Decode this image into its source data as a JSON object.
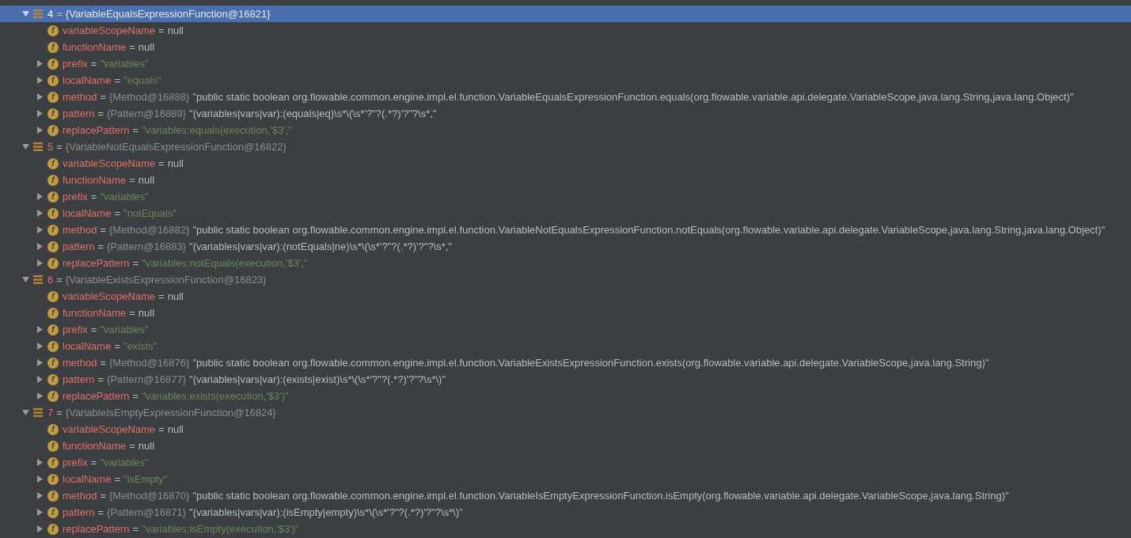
{
  "groups": [
    {
      "index": "4",
      "op": "=",
      "value": "{VariableEqualsExpressionFunction@16821}",
      "expanded": true,
      "selected": true,
      "children": [
        {
          "icon": "f",
          "name": "variableScopeName",
          "op": "=",
          "kind": "null",
          "value": "null",
          "expandable": false
        },
        {
          "icon": "f",
          "name": "functionName",
          "op": "=",
          "kind": "null",
          "value": "null",
          "expandable": false
        },
        {
          "icon": "f",
          "name": "prefix",
          "op": "=",
          "kind": "string",
          "value": "\"variables\"",
          "expandable": true
        },
        {
          "icon": "f",
          "name": "localName",
          "op": "=",
          "kind": "string",
          "value": "\"equals\"",
          "expandable": true
        },
        {
          "icon": "f",
          "name": "method",
          "op": "=",
          "kind": "object",
          "ref": "{Method@16888}",
          "value": "\"public static boolean org.flowable.common.engine.impl.el.function.VariableEqualsExpressionFunction.equals(org.flowable.variable.api.delegate.VariableScope,java.lang.String,java.lang.Object)\"",
          "expandable": true
        },
        {
          "icon": "f",
          "name": "pattern",
          "op": "=",
          "kind": "object",
          "ref": "{Pattern@16889}",
          "value": "\"(variables|vars|var):(equals|eq)\\s*\\(\\s*'?\"?(.*?)'?\"?\\s*,\"",
          "expandable": true
        },
        {
          "icon": "f",
          "name": "replacePattern",
          "op": "=",
          "kind": "string",
          "value": "\"variables:equals(execution,'$3',\"",
          "expandable": true
        }
      ]
    },
    {
      "index": "5",
      "op": "=",
      "value": "{VariableNotEqualsExpressionFunction@16822}",
      "expanded": true,
      "selected": false,
      "children": [
        {
          "icon": "f",
          "name": "variableScopeName",
          "op": "=",
          "kind": "null",
          "value": "null",
          "expandable": false
        },
        {
          "icon": "f",
          "name": "functionName",
          "op": "=",
          "kind": "null",
          "value": "null",
          "expandable": false
        },
        {
          "icon": "f",
          "name": "prefix",
          "op": "=",
          "kind": "string",
          "value": "\"variables\"",
          "expandable": true
        },
        {
          "icon": "f",
          "name": "localName",
          "op": "=",
          "kind": "string",
          "value": "\"notEquals\"",
          "expandable": true
        },
        {
          "icon": "f",
          "name": "method",
          "op": "=",
          "kind": "object",
          "ref": "{Method@16882}",
          "value": "\"public static boolean org.flowable.common.engine.impl.el.function.VariableNotEqualsExpressionFunction.notEquals(org.flowable.variable.api.delegate.VariableScope,java.lang.String,java.lang.Object)\"",
          "expandable": true
        },
        {
          "icon": "f",
          "name": "pattern",
          "op": "=",
          "kind": "object",
          "ref": "{Pattern@16883}",
          "value": "\"(variables|vars|var):(notEquals|ne)\\s*\\(\\s*'?\"?(.*?)'?\"?\\s*,\"",
          "expandable": true
        },
        {
          "icon": "f",
          "name": "replacePattern",
          "op": "=",
          "kind": "string",
          "value": "\"variables:notEquals(execution,'$3',\"",
          "expandable": true
        }
      ]
    },
    {
      "index": "6",
      "op": "=",
      "value": "{VariableExistsExpressionFunction@16823}",
      "expanded": true,
      "selected": false,
      "children": [
        {
          "icon": "f",
          "name": "variableScopeName",
          "op": "=",
          "kind": "null",
          "value": "null",
          "expandable": false
        },
        {
          "icon": "f",
          "name": "functionName",
          "op": "=",
          "kind": "null",
          "value": "null",
          "expandable": false
        },
        {
          "icon": "f",
          "name": "prefix",
          "op": "=",
          "kind": "string",
          "value": "\"variables\"",
          "expandable": true
        },
        {
          "icon": "f",
          "name": "localName",
          "op": "=",
          "kind": "string",
          "value": "\"exists\"",
          "expandable": true
        },
        {
          "icon": "f",
          "name": "method",
          "op": "=",
          "kind": "object",
          "ref": "{Method@16876}",
          "value": "\"public static boolean org.flowable.common.engine.impl.el.function.VariableExistsExpressionFunction.exists(org.flowable.variable.api.delegate.VariableScope,java.lang.String)\"",
          "expandable": true
        },
        {
          "icon": "f",
          "name": "pattern",
          "op": "=",
          "kind": "object",
          "ref": "{Pattern@16877}",
          "value": "\"(variables|vars|var):(exists|exist)\\s*\\(\\s*'?\"?(.*?)'?\"?\\s*\\)\"",
          "expandable": true
        },
        {
          "icon": "f",
          "name": "replacePattern",
          "op": "=",
          "kind": "string",
          "value": "\"variables:exists(execution,'$3')\"",
          "expandable": true
        }
      ]
    },
    {
      "index": "7",
      "op": "=",
      "value": "{VariableIsEmptyExpressionFunction@16824}",
      "expanded": true,
      "selected": false,
      "children": [
        {
          "icon": "f",
          "name": "variableScopeName",
          "op": "=",
          "kind": "null",
          "value": "null",
          "expandable": false
        },
        {
          "icon": "f",
          "name": "functionName",
          "op": "=",
          "kind": "null",
          "value": "null",
          "expandable": false
        },
        {
          "icon": "f",
          "name": "prefix",
          "op": "=",
          "kind": "string",
          "value": "\"variables\"",
          "expandable": true
        },
        {
          "icon": "f",
          "name": "localName",
          "op": "=",
          "kind": "string",
          "value": "\"isEmpty\"",
          "expandable": true
        },
        {
          "icon": "f",
          "name": "method",
          "op": "=",
          "kind": "object",
          "ref": "{Method@16870}",
          "value": "\"public static boolean org.flowable.common.engine.impl.el.function.VariableIsEmptyExpressionFunction.isEmpty(org.flowable.variable.api.delegate.VariableScope,java.lang.String)\"",
          "expandable": true
        },
        {
          "icon": "f",
          "name": "pattern",
          "op": "=",
          "kind": "object",
          "ref": "{Pattern@16871}",
          "value": "\"(variables|vars|var):(isEmpty|empty)\\s*\\(\\s*'?\"?(.*?)'?\"?\\s*\\)\"",
          "expandable": true
        },
        {
          "icon": "f",
          "name": "replacePattern",
          "op": "=",
          "kind": "string",
          "value": "\"variables:isEmpty(execution,'$3')\"",
          "expandable": true
        }
      ]
    }
  ]
}
